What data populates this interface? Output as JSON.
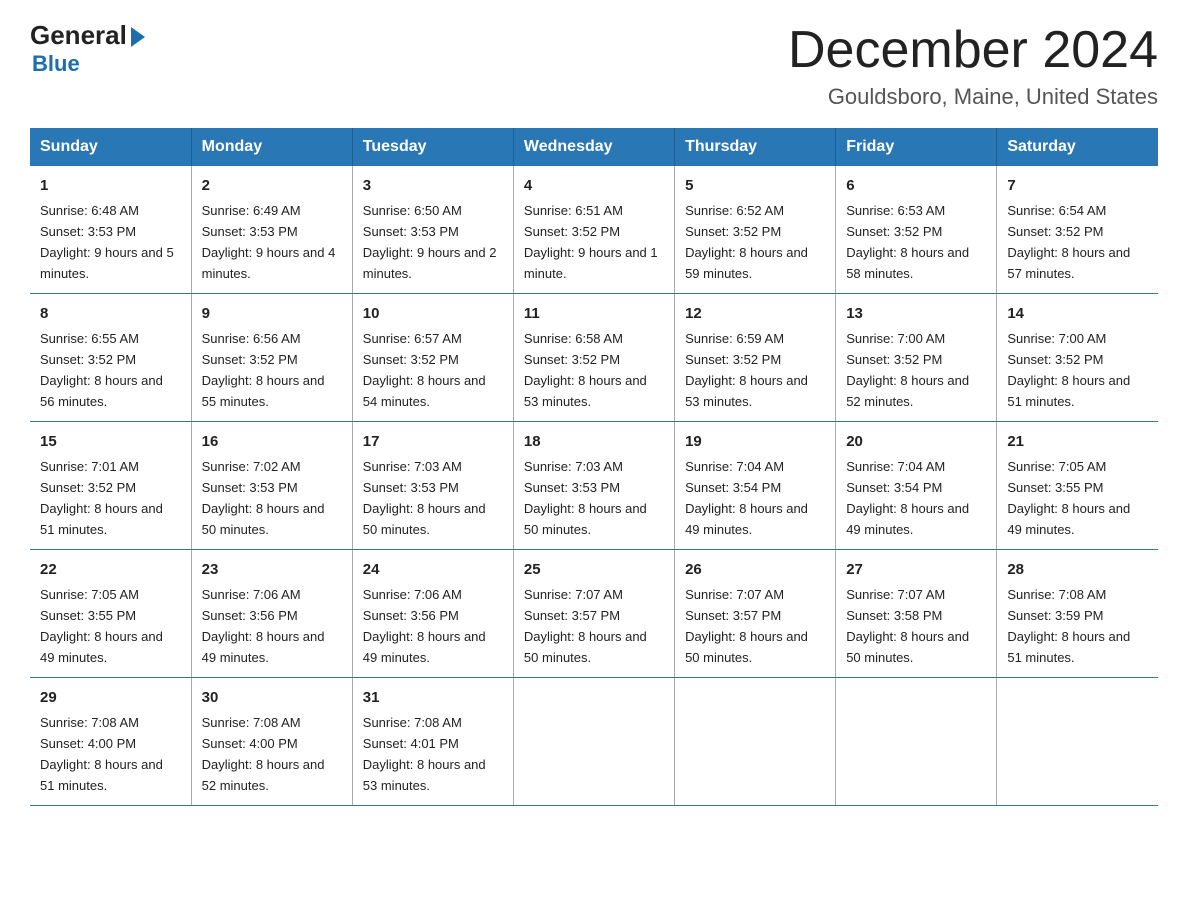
{
  "logo": {
    "general": "General",
    "blue": "Blue"
  },
  "title": {
    "month_year": "December 2024",
    "location": "Gouldsboro, Maine, United States"
  },
  "headers": [
    "Sunday",
    "Monday",
    "Tuesday",
    "Wednesday",
    "Thursday",
    "Friday",
    "Saturday"
  ],
  "weeks": [
    [
      {
        "day": "1",
        "sunrise": "6:48 AM",
        "sunset": "3:53 PM",
        "daylight": "9 hours and 5 minutes."
      },
      {
        "day": "2",
        "sunrise": "6:49 AM",
        "sunset": "3:53 PM",
        "daylight": "9 hours and 4 minutes."
      },
      {
        "day": "3",
        "sunrise": "6:50 AM",
        "sunset": "3:53 PM",
        "daylight": "9 hours and 2 minutes."
      },
      {
        "day": "4",
        "sunrise": "6:51 AM",
        "sunset": "3:52 PM",
        "daylight": "9 hours and 1 minute."
      },
      {
        "day": "5",
        "sunrise": "6:52 AM",
        "sunset": "3:52 PM",
        "daylight": "8 hours and 59 minutes."
      },
      {
        "day": "6",
        "sunrise": "6:53 AM",
        "sunset": "3:52 PM",
        "daylight": "8 hours and 58 minutes."
      },
      {
        "day": "7",
        "sunrise": "6:54 AM",
        "sunset": "3:52 PM",
        "daylight": "8 hours and 57 minutes."
      }
    ],
    [
      {
        "day": "8",
        "sunrise": "6:55 AM",
        "sunset": "3:52 PM",
        "daylight": "8 hours and 56 minutes."
      },
      {
        "day": "9",
        "sunrise": "6:56 AM",
        "sunset": "3:52 PM",
        "daylight": "8 hours and 55 minutes."
      },
      {
        "day": "10",
        "sunrise": "6:57 AM",
        "sunset": "3:52 PM",
        "daylight": "8 hours and 54 minutes."
      },
      {
        "day": "11",
        "sunrise": "6:58 AM",
        "sunset": "3:52 PM",
        "daylight": "8 hours and 53 minutes."
      },
      {
        "day": "12",
        "sunrise": "6:59 AM",
        "sunset": "3:52 PM",
        "daylight": "8 hours and 53 minutes."
      },
      {
        "day": "13",
        "sunrise": "7:00 AM",
        "sunset": "3:52 PM",
        "daylight": "8 hours and 52 minutes."
      },
      {
        "day": "14",
        "sunrise": "7:00 AM",
        "sunset": "3:52 PM",
        "daylight": "8 hours and 51 minutes."
      }
    ],
    [
      {
        "day": "15",
        "sunrise": "7:01 AM",
        "sunset": "3:52 PM",
        "daylight": "8 hours and 51 minutes."
      },
      {
        "day": "16",
        "sunrise": "7:02 AM",
        "sunset": "3:53 PM",
        "daylight": "8 hours and 50 minutes."
      },
      {
        "day": "17",
        "sunrise": "7:03 AM",
        "sunset": "3:53 PM",
        "daylight": "8 hours and 50 minutes."
      },
      {
        "day": "18",
        "sunrise": "7:03 AM",
        "sunset": "3:53 PM",
        "daylight": "8 hours and 50 minutes."
      },
      {
        "day": "19",
        "sunrise": "7:04 AM",
        "sunset": "3:54 PM",
        "daylight": "8 hours and 49 minutes."
      },
      {
        "day": "20",
        "sunrise": "7:04 AM",
        "sunset": "3:54 PM",
        "daylight": "8 hours and 49 minutes."
      },
      {
        "day": "21",
        "sunrise": "7:05 AM",
        "sunset": "3:55 PM",
        "daylight": "8 hours and 49 minutes."
      }
    ],
    [
      {
        "day": "22",
        "sunrise": "7:05 AM",
        "sunset": "3:55 PM",
        "daylight": "8 hours and 49 minutes."
      },
      {
        "day": "23",
        "sunrise": "7:06 AM",
        "sunset": "3:56 PM",
        "daylight": "8 hours and 49 minutes."
      },
      {
        "day": "24",
        "sunrise": "7:06 AM",
        "sunset": "3:56 PM",
        "daylight": "8 hours and 49 minutes."
      },
      {
        "day": "25",
        "sunrise": "7:07 AM",
        "sunset": "3:57 PM",
        "daylight": "8 hours and 50 minutes."
      },
      {
        "day": "26",
        "sunrise": "7:07 AM",
        "sunset": "3:57 PM",
        "daylight": "8 hours and 50 minutes."
      },
      {
        "day": "27",
        "sunrise": "7:07 AM",
        "sunset": "3:58 PM",
        "daylight": "8 hours and 50 minutes."
      },
      {
        "day": "28",
        "sunrise": "7:08 AM",
        "sunset": "3:59 PM",
        "daylight": "8 hours and 51 minutes."
      }
    ],
    [
      {
        "day": "29",
        "sunrise": "7:08 AM",
        "sunset": "4:00 PM",
        "daylight": "8 hours and 51 minutes."
      },
      {
        "day": "30",
        "sunrise": "7:08 AM",
        "sunset": "4:00 PM",
        "daylight": "8 hours and 52 minutes."
      },
      {
        "day": "31",
        "sunrise": "7:08 AM",
        "sunset": "4:01 PM",
        "daylight": "8 hours and 53 minutes."
      },
      null,
      null,
      null,
      null
    ]
  ]
}
